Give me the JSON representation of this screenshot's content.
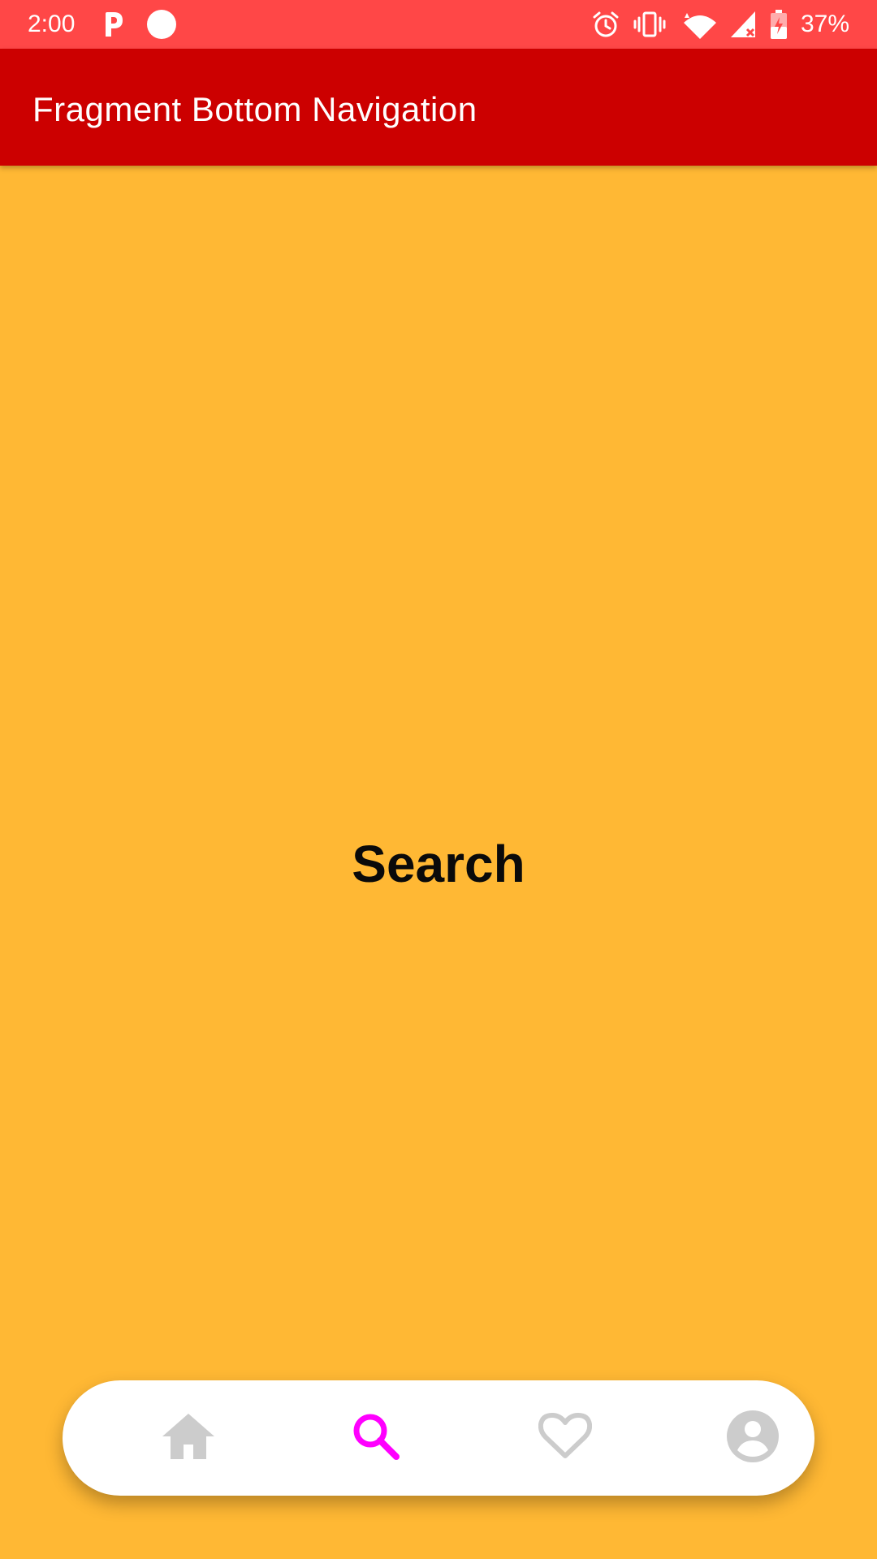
{
  "status_bar": {
    "time": "2:00",
    "battery_text": "37%",
    "left_icons": [
      "parking-p-icon",
      "circle-notification-icon"
    ],
    "right_icons": [
      "alarm-icon",
      "vibrate-icon",
      "wifi-icon",
      "cell-signal-icon",
      "battery-charging-icon"
    ],
    "background": "#FF4747"
  },
  "app_bar": {
    "title": "Fragment Bottom Navigation",
    "background": "#CC0000"
  },
  "content": {
    "label": "Search",
    "background": "#FFB834"
  },
  "bottom_nav": {
    "items": [
      {
        "name": "home",
        "icon": "home-icon",
        "selected": false
      },
      {
        "name": "search",
        "icon": "search-icon",
        "selected": true
      },
      {
        "name": "favorites",
        "icon": "heart-icon",
        "selected": false
      },
      {
        "name": "profile",
        "icon": "account-circle-icon",
        "selected": false
      }
    ],
    "selected_color": "#FF00FF",
    "unselected_color": "#CCCCCC"
  }
}
